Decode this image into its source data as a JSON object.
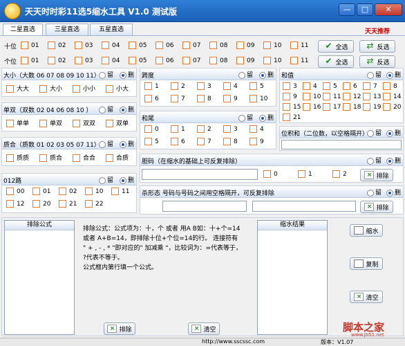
{
  "app": {
    "title": "天天时时彩11选5缩水工具 V1.0 测试版"
  },
  "window": {
    "min": "—",
    "max": "□",
    "close": "✕"
  },
  "tabs": [
    "二星直选",
    "三星直选",
    "五星直选"
  ],
  "recommend": "天天推荐",
  "numbers11": [
    "01",
    "02",
    "03",
    "04",
    "05",
    "06",
    "07",
    "08",
    "09",
    "10",
    "11"
  ],
  "rows": {
    "shi": "十位",
    "ge": "个位"
  },
  "buttons": {
    "all": "全选",
    "invert": "反选",
    "exclude": "排除",
    "clear": "清空",
    "shrink": "缩水",
    "copy": "复制"
  },
  "radio": {
    "keep": "留",
    "del": "删"
  },
  "size": {
    "title": "大小（大数 06 07 08 09 10 11）",
    "opts": [
      "大大",
      "大小",
      "小小",
      "小大"
    ]
  },
  "oddeven": {
    "title": "单双（双数 02 04 06 08 10 ）",
    "opts": [
      "单单",
      "单双",
      "双双",
      "双单"
    ]
  },
  "prime": {
    "title": "质合（质数 01 02 03 05 07 11）",
    "opts": [
      "质质",
      "质合",
      "合合",
      "合质"
    ]
  },
  "route012": {
    "title": "012路",
    "opts": [
      "00",
      "01",
      "02",
      "10",
      "11",
      "12",
      "20",
      "21",
      "22"
    ]
  },
  "span": {
    "title": "跨度",
    "opts": [
      "1",
      "2",
      "3",
      "4",
      "5",
      "6",
      "7",
      "8",
      "9",
      "10"
    ]
  },
  "tail": {
    "title": "和尾",
    "opts": [
      "0",
      "1",
      "2",
      "3",
      "4",
      "5",
      "6",
      "7",
      "8",
      "9"
    ]
  },
  "sumv": {
    "title": "和值",
    "opts": [
      "3",
      "4",
      "5",
      "6",
      "7",
      "8",
      "9",
      "10",
      "11",
      "12",
      "13",
      "14",
      "15",
      "16",
      "17",
      "18",
      "19",
      "20",
      "21"
    ]
  },
  "possum": {
    "title": "位积和（二位数，以空格隔开）"
  },
  "dan": {
    "title": "胆码（在缩水的基础上可反复排除）",
    "opts": [
      "0",
      "1",
      "2"
    ]
  },
  "shape": {
    "title": "杀形态 号码与号码之间用空格隔开，可反复排除"
  },
  "formula": {
    "header": "排除公式",
    "desc": [
      "排除公式：公式项为：十，个 或者 用A B如：十+个=14",
      "或者 A+B=14，即排除十位+个位=14的行。 连接符有",
      "\" + , - , * \"即对应的\" 加减乘 \"，比较词为：=代表等于，",
      "?代表不等于。",
      "公式框内第行填一个公式。"
    ]
  },
  "result": {
    "header": "缩水结果"
  },
  "status": {
    "url": "http://www.sscssc.com",
    "version": "版本：V1.07"
  },
  "watermark": {
    "text": "脚本之家",
    "url": "www.jb51.net"
  }
}
